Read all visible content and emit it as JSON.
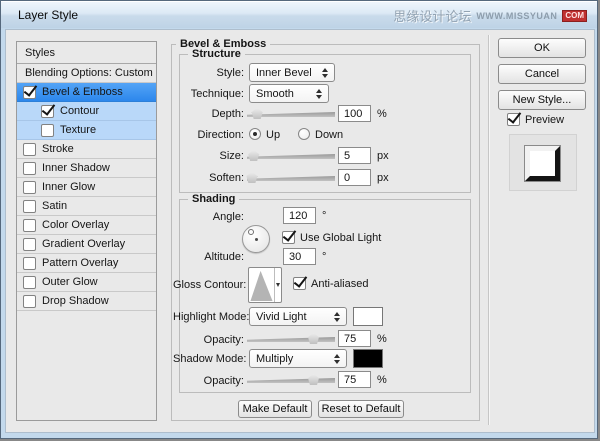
{
  "window": {
    "title": "Layer Style"
  },
  "watermark": {
    "site_cn": "思缘设计论坛",
    "site_en": "WWW.MISSYUAN",
    "badge": "COM"
  },
  "colors": {
    "selection_blue": "#3b94f2",
    "selection_light_blue": "#b9d8f9",
    "titlebar_blue": "#cfe0ef",
    "dialog_bg": "#e9e9e9",
    "highlight_swatch": "#ffffff",
    "shadow_swatch": "#000000",
    "watermark_badge_red": "#bf3030"
  },
  "sidebar": {
    "items": [
      {
        "label": "Styles"
      },
      {
        "label": "Blending Options: Custom"
      },
      {
        "label": "Bevel & Emboss",
        "checked": true,
        "selected": true
      },
      {
        "label": "Contour",
        "checked": true
      },
      {
        "label": "Texture",
        "checked": false
      },
      {
        "label": "Stroke",
        "checked": false
      },
      {
        "label": "Inner Shadow",
        "checked": false
      },
      {
        "label": "Inner Glow",
        "checked": false
      },
      {
        "label": "Satin",
        "checked": false
      },
      {
        "label": "Color Overlay",
        "checked": false
      },
      {
        "label": "Gradient Overlay",
        "checked": false
      },
      {
        "label": "Pattern Overlay",
        "checked": false
      },
      {
        "label": "Outer Glow",
        "checked": false
      },
      {
        "label": "Drop Shadow",
        "checked": false
      }
    ]
  },
  "panel": {
    "title": "Bevel & Emboss",
    "structure": {
      "title": "Structure",
      "style_label": "Style:",
      "style_value": "Inner Bevel",
      "technique_label": "Technique:",
      "technique_value": "Smooth",
      "depth_label": "Depth:",
      "depth_value": "100",
      "depth_unit": "%",
      "direction_label": "Direction:",
      "direction_up": "Up",
      "direction_down": "Down",
      "size_label": "Size:",
      "size_value": "5",
      "size_unit": "px",
      "soften_label": "Soften:",
      "soften_value": "0",
      "soften_unit": "px"
    },
    "shading": {
      "title": "Shading",
      "angle_label": "Angle:",
      "angle_value": "120",
      "angle_unit": "°",
      "use_global_light_label": "Use Global Light",
      "use_global_light_checked": true,
      "altitude_label": "Altitude:",
      "altitude_value": "30",
      "altitude_unit": "°",
      "gloss_contour_label": "Gloss Contour:",
      "anti_aliased_label": "Anti-aliased",
      "anti_aliased_checked": true,
      "highlight_mode_label": "Highlight Mode:",
      "highlight_mode_value": "Vivid Light",
      "highlight_color": "#ffffff",
      "opacity1_label": "Opacity:",
      "opacity1_value": "75",
      "opacity1_unit": "%",
      "shadow_mode_label": "Shadow Mode:",
      "shadow_mode_value": "Multiply",
      "shadow_color": "#000000",
      "opacity2_label": "Opacity:",
      "opacity2_value": "75",
      "opacity2_unit": "%"
    },
    "footer_buttons": {
      "make_default": "Make Default",
      "reset_to_default": "Reset to Default"
    }
  },
  "actions": {
    "ok": "OK",
    "cancel": "Cancel",
    "new_style": "New Style...",
    "preview_label": "Preview",
    "preview_checked": true
  }
}
